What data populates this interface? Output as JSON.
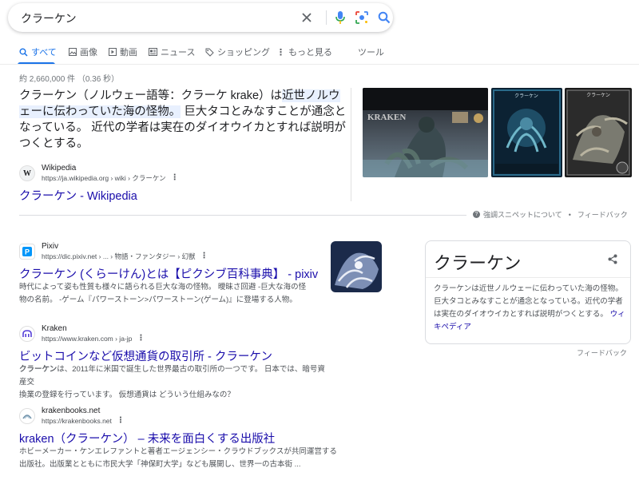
{
  "search": {
    "query": "クラーケン"
  },
  "tabs": [
    {
      "label": "すべて",
      "icon": "search-icon",
      "active": true
    },
    {
      "label": "画像",
      "icon": "image-icon"
    },
    {
      "label": "動画",
      "icon": "video-icon"
    },
    {
      "label": "ニュース",
      "icon": "news-icon"
    },
    {
      "label": "ショッピング",
      "icon": "tag-icon"
    },
    {
      "label": "もっと見る",
      "icon": "more-vert-icon"
    },
    {
      "label": "ツール"
    }
  ],
  "stats": "約 2,660,000 件 （0.36 秒）",
  "featured_snippet": {
    "text_before": "クラーケン（ノルウェー語等：クラーケ krake）は",
    "text_highlight": "近世ノルウェーに伝わっていた海の怪物。",
    "text_after": " 巨大タコとみなすことが通念となっている。 近代の学者は実在のダイオウイカとすれば説明がつくとする。",
    "source_name": "Wikipedia",
    "source_url": "https://ja.wikipedia.org › wiki › クラーケン",
    "title": "クラーケン - Wikipedia",
    "favicon_letter": "W"
  },
  "images": [
    {
      "label": "KRAKEN",
      "name": "kraken-movie-poster"
    },
    {
      "label": "クラーケン",
      "name": "kraken-card"
    },
    {
      "label": "クラーケン",
      "name": "kraken-art"
    }
  ],
  "snippet_feedback": {
    "about": "強調スニペットについて",
    "feedback": "フィードバック"
  },
  "results": [
    {
      "source": "Pixiv",
      "url": "https://dic.pixiv.net › ... › 物語・ファンタジー › 幻獣",
      "title": "クラーケン (くらーけん)とは【ピクシブ百科事典】 - pixiv",
      "desc_line1": "時代によって姿も性質も様々に語られる巨大な海の怪物。 曖昧さ回避 -巨大な海の怪",
      "desc_line2": "物の名前。 -ゲーム『パワーストーン>パワーストーン(ゲーム)』に登場する人物。"
    },
    {
      "source": "Kraken",
      "url": "https://www.kraken.com › ja-jp",
      "title": "ビットコインなど仮想通貨の取引所 - クラーケン",
      "desc_bold": "クラーケン",
      "desc_line1": "は、2011年に米国で誕生した世界最古の取引所の一つです。 日本では、暗号資産交",
      "desc_line2": "換業の登録を行っています。 仮想通貨は どういう仕組みなの？"
    },
    {
      "source": "krakenbooks.net",
      "url": "https://krakenbooks.net",
      "title": "kraken（クラーケン） – 未来を面白くする出版社",
      "desc_line1": "ホビーメーカー・ケンエレファントと著者エージェンシー・クラウドブックスが共同運営する",
      "desc_line2": "出版社。出版業とともに市民大学「神保町大学」なども展開し、世界一の古本街 ..."
    }
  ],
  "knowledge_panel": {
    "title": "クラーケン",
    "desc": "クラーケンは近世ノルウェーに伝わっていた海の怪物。巨大タコとみなすことが通念となっている。近代の学者は実在のダイオウイカとすれば説明がつくとする。",
    "link": "ウィキペディア",
    "feedback": "フィードバック"
  },
  "colors": {
    "accent": "#1a73e8",
    "link": "#1a0dab",
    "text": "#202124",
    "muted": "#4d5156"
  }
}
